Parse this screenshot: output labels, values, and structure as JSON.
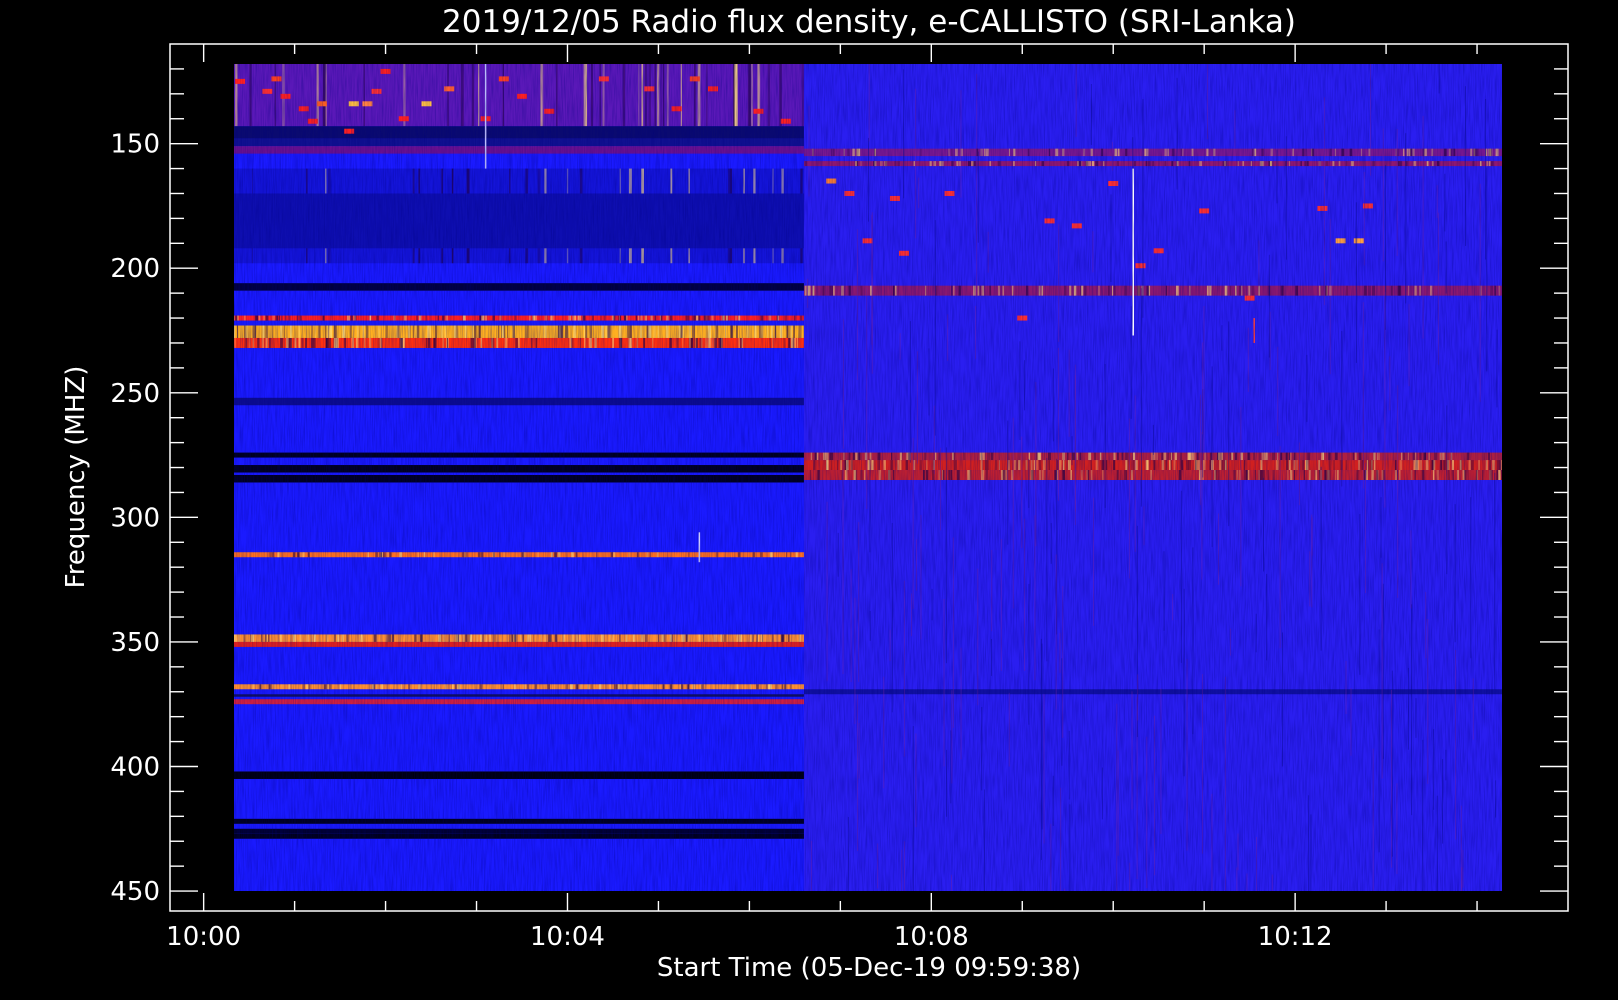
{
  "chart_data": {
    "type": "heatmap",
    "title": "2019/12/05  Radio flux density, e-CALLISTO (SRI-Lanka)",
    "xlabel": "Start Time (05-Dec-19 09:59:38)",
    "ylabel": "Frequency (MHZ)",
    "y_inverted": true,
    "ylim": [
      458,
      110
    ],
    "xlim_minutes": [
      -0.37,
      15.0
    ],
    "x_ticks": [
      {
        "minute": 0,
        "label": "10:00"
      },
      {
        "minute": 4,
        "label": "10:04"
      },
      {
        "minute": 8,
        "label": "10:08"
      },
      {
        "minute": 12,
        "label": "10:12"
      }
    ],
    "y_ticks": [
      150,
      200,
      250,
      300,
      350,
      400,
      450
    ],
    "data_extent": {
      "t_start_min": 0.0,
      "t_end_min": 14.98,
      "f_min": 112,
      "f_max": 460
    },
    "segment_split_min": 6.6,
    "grid": false,
    "legend": "none",
    "colormap": [
      "#000000",
      "#1010ff",
      "#8000a0",
      "#ff0000",
      "#ffa000",
      "#ffff80"
    ],
    "background_color": "#1a1aff",
    "segments": [
      {
        "t_start": 0.0,
        "t_end": 6.6,
        "base_color": "#1a1aff",
        "bands": [
          {
            "f0": 112,
            "f1": 143,
            "color": "#5a18b8",
            "texture": 0.35
          },
          {
            "f0": 143,
            "f1": 148,
            "color": "#0a0a70"
          },
          {
            "f0": 148,
            "f1": 151,
            "color": "#101090"
          },
          {
            "f0": 151,
            "f1": 154,
            "color": "#6a1090"
          },
          {
            "f0": 160,
            "f1": 198,
            "color": "#1414d8",
            "texture": 0.2
          },
          {
            "f0": 170,
            "f1": 192,
            "color": "#0e0eb0"
          },
          {
            "f0": 206,
            "f1": 209,
            "color": "#000040"
          },
          {
            "f0": 219,
            "f1": 221,
            "color": "#ff2020",
            "texture": 0.8
          },
          {
            "f0": 223,
            "f1": 228,
            "color": "#ffb020",
            "texture": 0.9
          },
          {
            "f0": 228,
            "f1": 232,
            "color": "#ff3010",
            "texture": 0.8
          },
          {
            "f0": 252,
            "f1": 255,
            "color": "#0c0c90"
          },
          {
            "f0": 274,
            "f1": 276,
            "color": "#000020"
          },
          {
            "f0": 279,
            "f1": 282,
            "color": "#000020"
          },
          {
            "f0": 283,
            "f1": 286,
            "color": "#000020"
          },
          {
            "f0": 314,
            "f1": 316,
            "color": "#ff7020",
            "texture": 0.4
          },
          {
            "f0": 347,
            "f1": 350,
            "color": "#ff9030",
            "texture": 0.8
          },
          {
            "f0": 350,
            "f1": 352,
            "color": "#e02020"
          },
          {
            "f0": 367,
            "f1": 369,
            "color": "#ff9030",
            "texture": 0.5
          },
          {
            "f0": 371,
            "f1": 372,
            "color": "#101060"
          },
          {
            "f0": 373,
            "f1": 375,
            "color": "#d02040"
          },
          {
            "f0": 402,
            "f1": 405,
            "color": "#000010"
          },
          {
            "f0": 421,
            "f1": 423,
            "color": "#000020"
          },
          {
            "f0": 425,
            "f1": 427,
            "color": "#000030"
          },
          {
            "f0": 427,
            "f1": 429,
            "color": "#000020"
          },
          {
            "f0": 453,
            "f1": 460,
            "color": "#b01020",
            "texture": 0.4
          }
        ],
        "spots": [
          {
            "t": 0.4,
            "f": 125,
            "color": "#ff2020"
          },
          {
            "t": 0.7,
            "f": 129,
            "color": "#ff3030"
          },
          {
            "t": 0.8,
            "f": 124,
            "color": "#ff4020"
          },
          {
            "t": 0.9,
            "f": 131,
            "color": "#ff2020"
          },
          {
            "t": 1.1,
            "f": 136,
            "color": "#ff2020"
          },
          {
            "t": 1.2,
            "f": 141,
            "color": "#ff2020"
          },
          {
            "t": 1.3,
            "f": 134,
            "color": "#ff6020"
          },
          {
            "t": 1.6,
            "f": 145,
            "color": "#ff2020"
          },
          {
            "t": 1.8,
            "f": 134,
            "color": "#ff8040"
          },
          {
            "t": 1.9,
            "f": 129,
            "color": "#ff3030"
          },
          {
            "t": 2.0,
            "f": 121,
            "color": "#ff2020"
          },
          {
            "t": 2.2,
            "f": 140,
            "color": "#ff2020"
          },
          {
            "t": 2.4,
            "f": 115,
            "color": "#ff2020"
          },
          {
            "t": 2.7,
            "f": 128,
            "color": "#ff6030"
          },
          {
            "t": 3.0,
            "f": 115,
            "color": "#ff2020"
          },
          {
            "t": 3.1,
            "f": 140,
            "color": "#ff2020"
          },
          {
            "t": 3.3,
            "f": 124,
            "color": "#ff4020"
          },
          {
            "t": 3.5,
            "f": 131,
            "color": "#ff2020"
          },
          {
            "t": 3.8,
            "f": 137,
            "color": "#ff2020"
          },
          {
            "t": 4.1,
            "f": 115,
            "color": "#ff2020"
          },
          {
            "t": 4.4,
            "f": 124,
            "color": "#ff3030"
          },
          {
            "t": 4.6,
            "f": 115,
            "color": "#ff2020"
          },
          {
            "t": 4.9,
            "f": 128,
            "color": "#ff3030"
          },
          {
            "t": 5.2,
            "f": 136,
            "color": "#ff2020"
          },
          {
            "t": 5.4,
            "f": 124,
            "color": "#ff4020"
          },
          {
            "t": 5.6,
            "f": 128,
            "color": "#ff2020"
          },
          {
            "t": 5.9,
            "f": 115,
            "color": "#ff2020"
          },
          {
            "t": 6.1,
            "f": 137,
            "color": "#ff2020"
          },
          {
            "t": 6.4,
            "f": 141,
            "color": "#ff2020"
          },
          {
            "t": 6.5,
            "f": 115,
            "color": "#ff2020"
          },
          {
            "t": 1.65,
            "f": 134,
            "color": "#ffc040"
          },
          {
            "t": 2.45,
            "f": 134,
            "color": "#ffc040"
          }
        ]
      },
      {
        "t_start": 6.6,
        "t_end": 14.98,
        "base_color": "#2a1ef0",
        "bands": [
          {
            "f0": 152,
            "f1": 155,
            "color": "#7a1890",
            "texture": 0.5
          },
          {
            "f0": 157,
            "f1": 159,
            "color": "#901870",
            "texture": 0.5
          },
          {
            "f0": 207,
            "f1": 211,
            "color": "#8a1870",
            "texture": 0.5
          },
          {
            "f0": 274,
            "f1": 277,
            "color": "#b02040",
            "texture": 0.7
          },
          {
            "f0": 277,
            "f1": 281,
            "color": "#d02020",
            "texture": 0.8
          },
          {
            "f0": 281,
            "f1": 285,
            "color": "#c02030",
            "texture": 0.7
          },
          {
            "f0": 369,
            "f1": 371,
            "color": "#1010a0"
          }
        ],
        "spots": [
          {
            "t": 6.9,
            "f": 165,
            "color": "#ff8030"
          },
          {
            "t": 7.1,
            "f": 170,
            "color": "#ff3030"
          },
          {
            "t": 7.3,
            "f": 189,
            "color": "#ff3030"
          },
          {
            "t": 7.6,
            "f": 172,
            "color": "#ff3030"
          },
          {
            "t": 7.7,
            "f": 194,
            "color": "#ff3030"
          },
          {
            "t": 8.2,
            "f": 170,
            "color": "#ff3030"
          },
          {
            "t": 9.3,
            "f": 181,
            "color": "#ff3030"
          },
          {
            "t": 9.6,
            "f": 183,
            "color": "#ff3030"
          },
          {
            "t": 10.0,
            "f": 166,
            "color": "#ff3030"
          },
          {
            "t": 10.3,
            "f": 199,
            "color": "#ff3030"
          },
          {
            "t": 10.5,
            "f": 193,
            "color": "#ff3030"
          },
          {
            "t": 11.0,
            "f": 177,
            "color": "#ff3030"
          },
          {
            "t": 12.3,
            "f": 176,
            "color": "#ff3030"
          },
          {
            "t": 12.5,
            "f": 189,
            "color": "#ffa040"
          },
          {
            "t": 12.7,
            "f": 189,
            "color": "#ffa040"
          },
          {
            "t": 12.8,
            "f": 175,
            "color": "#ff3030"
          },
          {
            "t": 9.0,
            "f": 220,
            "color": "#ff3030"
          },
          {
            "t": 11.5,
            "f": 212,
            "color": "#ff3030"
          }
        ]
      }
    ],
    "vlines": [
      {
        "t": 10.22,
        "f0": 160,
        "f1": 227,
        "color": "#ffffff"
      },
      {
        "t": 3.1,
        "f0": 112,
        "f1": 160,
        "color": "#c0c0ff"
      },
      {
        "t": 5.45,
        "f0": 306,
        "f1": 318,
        "color": "#d0d0ff"
      },
      {
        "t": 11.55,
        "f0": 220,
        "f1": 230,
        "color": "#ff4040"
      }
    ]
  }
}
